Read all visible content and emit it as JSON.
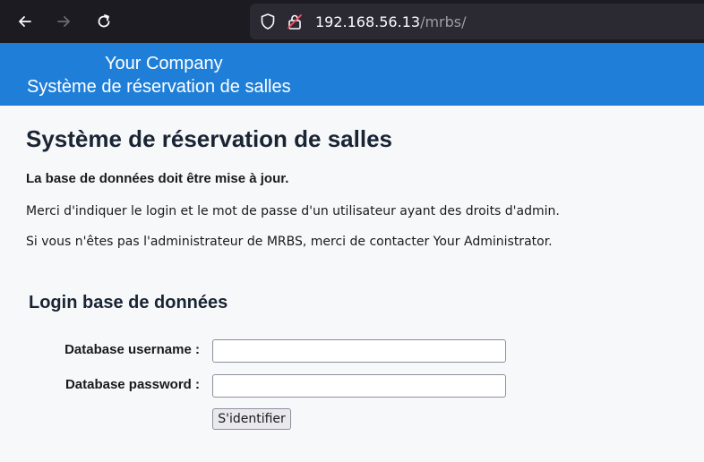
{
  "browser": {
    "url_host": "192.168.56.13",
    "url_path": "/mrbs/",
    "back_icon": "arrow-left",
    "forward_icon": "arrow-right",
    "reload_icon": "reload",
    "shield_icon": "shield",
    "lock_icon": "lock-insecure"
  },
  "banner": {
    "company": "Your Company",
    "system_name": "Système de réservation de salles",
    "background": "#1f7fd8"
  },
  "main": {
    "title": "Système de réservation de salles",
    "upgrade_notice": "La base de données doit être mise à jour.",
    "instructions": "Merci d'indiquer le login et le mot de passe d'un utilisateur ayant des droits d'admin.",
    "contact_note": "Si vous n'êtes pas l'administrateur de MRBS, merci de contacter Your Administrator."
  },
  "login_form": {
    "heading": "Login base de données",
    "username_label": "Database username :",
    "username_value": "",
    "password_label": "Database password :",
    "password_value": "",
    "submit_label": "S'identifier"
  }
}
